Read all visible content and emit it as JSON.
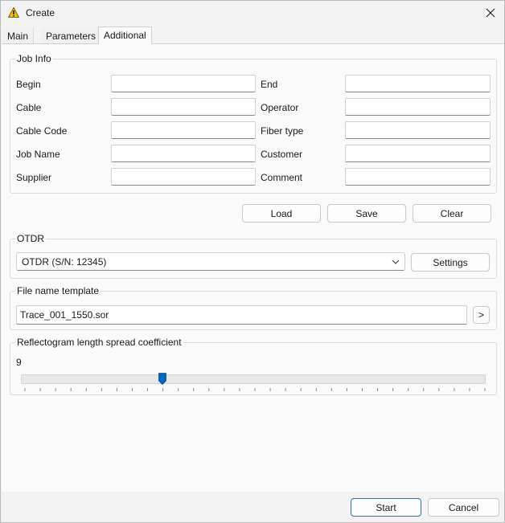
{
  "window": {
    "title": "Create",
    "icon": "warning-triangle-icon",
    "close_icon": "close-icon"
  },
  "tabs": [
    {
      "label": "Main",
      "active": false
    },
    {
      "label": "Parameters",
      "active": false
    },
    {
      "label": "Additional",
      "active": true
    }
  ],
  "job_info": {
    "legend": "Job Info",
    "left_fields": [
      {
        "label": "Begin",
        "value": ""
      },
      {
        "label": "Cable",
        "value": ""
      },
      {
        "label": "Cable Code",
        "value": ""
      },
      {
        "label": "Job Name",
        "value": ""
      },
      {
        "label": "Supplier",
        "value": ""
      }
    ],
    "right_fields": [
      {
        "label": "End",
        "value": ""
      },
      {
        "label": "Operator",
        "value": ""
      },
      {
        "label": "Fiber type",
        "value": ""
      },
      {
        "label": "Customer",
        "value": ""
      },
      {
        "label": "Comment",
        "value": ""
      }
    ]
  },
  "job_buttons": {
    "load": "Load",
    "save": "Save",
    "clear": "Clear"
  },
  "otdr": {
    "legend": "OTDR",
    "selected": "OTDR (S/N: 12345)",
    "settings_label": "Settings"
  },
  "file_template": {
    "legend": "File name template",
    "value": "Trace_001_1550.sor",
    "browse_label": ">"
  },
  "reflectogram": {
    "legend": "Reflectogram length spread coefficient",
    "value_text": "9",
    "slider_fraction": 0.305
  },
  "footer": {
    "start": "Start",
    "cancel": "Cancel"
  },
  "colors": {
    "accent": "#0067c0",
    "warning_yellow": "#f2c200"
  }
}
